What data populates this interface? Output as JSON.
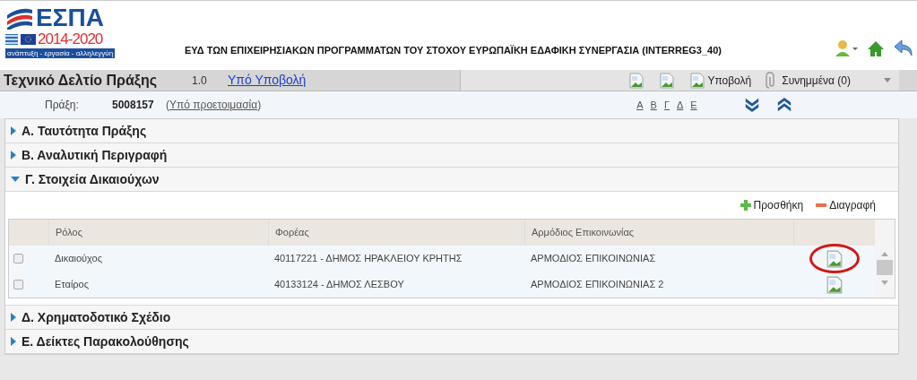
{
  "logo": {
    "title": "ΕΣΠΑ",
    "years": "2014-2020",
    "tagline": "ανάπτυξη - εργασία - αλληλεγγύη"
  },
  "header_title": "ΕΥΔ ΤΩΝ ΕΠΙΧΕΙΡΗΣΙΑΚΩΝ ΠΡΟΓΡΑΜΜΑΤΩΝ ΤΟΥ ΣΤΟΧΟΥ ΕΥΡΩΠΑΪΚΗ ΕΔΑΦΙΚΗ ΣΥΝΕΡΓΑΣΙΑ (INTERREG3_40)",
  "document": {
    "title": "Τεχνικό Δελτίο Πράξης",
    "version": "1.0",
    "status_link": "Υπό Υποβολή"
  },
  "toolbar": [
    {
      "kind": "image"
    },
    {
      "kind": "image"
    },
    {
      "kind": "image",
      "label": "Υποβολή"
    },
    {
      "kind": "attachment",
      "label": "Συνημμένα (0)"
    }
  ],
  "info": {
    "label": "Πράξη:",
    "code": "5008157",
    "status_open": "(",
    "status": "Υπό προετοιμασία",
    "status_close": ")"
  },
  "letters": [
    "Α",
    "Β",
    "Γ",
    "Δ",
    "Ε"
  ],
  "sections": [
    {
      "label": "Α. Ταυτότητα Πράξης",
      "expanded": false
    },
    {
      "label": "Β. Αναλυτική Περιγραφή",
      "expanded": false
    },
    {
      "label": "Γ. Στοιχεία Δικαιούχων",
      "expanded": true
    },
    {
      "label": "Δ. Χρηματοδοτικό Σχέδιο",
      "expanded": false
    },
    {
      "label": "Ε. Δείκτες Παρακολούθησης",
      "expanded": false
    }
  ],
  "table": {
    "actions": [
      {
        "kind": "add",
        "label": "Προσθήκη"
      },
      {
        "kind": "remove",
        "label": "Διαγραφή"
      }
    ],
    "columns": [
      "Ρόλος",
      "Φορέας",
      "Αρμόδιος Επικοινωνίας"
    ],
    "rows": [
      {
        "checked": false,
        "circled": true,
        "cells": [
          "Δικαιούχος",
          "40117221 - ΔΗΜΟΣ ΗΡΑΚΛΕΙΟΥ ΚΡΗΤΗΣ",
          "ΑΡΜΟΔΙΟΣ ΕΠΙΚΟΙΝΩΝΙΑΣ"
        ]
      },
      {
        "checked": false,
        "circled": false,
        "cells": [
          "Εταίρος",
          "40133124 - ΔΗΜΟΣ ΛΕΣΒΟΥ",
          "ΑΡΜΟΔΙΟΣ ΕΠΙΚΟΙΝΩΝΙΑΣ 2"
        ]
      }
    ]
  }
}
